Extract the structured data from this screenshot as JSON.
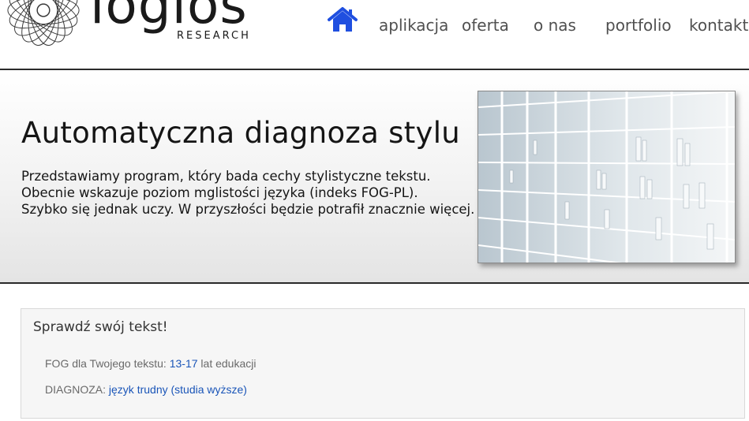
{
  "header": {
    "logo_word": "logios",
    "logo_sub": "RESEARCH",
    "nav": {
      "home_icon": "home-icon",
      "aplikacja": "aplikacja",
      "oferta": "oferta",
      "o_nas": "o nas",
      "portfolio": "portfolio",
      "kontakt": "kontakt"
    }
  },
  "hero": {
    "title": "Automatyczna diagnoza stylu",
    "lines": [
      "Przedstawiamy program, który bada cechy stylistyczne tekstu.",
      "Obecnie wskazuje poziom mglistości języka (indeks FOG-PL).",
      "Szybko się jednak uczy. W przyszłości będzie potrafił znacznie więcej."
    ],
    "image": "bookshelf-photo"
  },
  "check": {
    "title": "Sprawdź swój tekst!",
    "fog_label": "FOG dla Twojego tekstu:",
    "fog_value": "13-17",
    "fog_unit": "lat edukacji",
    "diag_label": "DIAGNOZA:",
    "diag_value": "język trudny (studia wyższe)"
  },
  "colors": {
    "nav_home": "#1f4fe0",
    "link": "#1a55b8",
    "rule": "#2a2a2a"
  }
}
